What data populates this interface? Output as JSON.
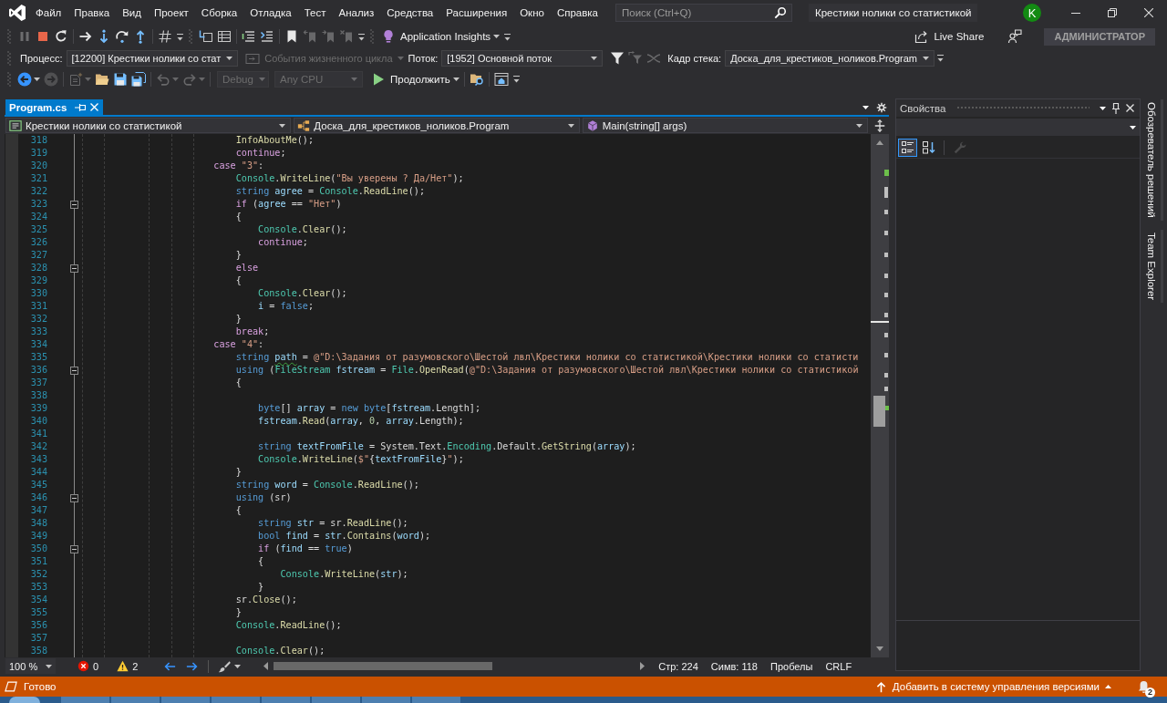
{
  "menu": [
    "Файл",
    "Правка",
    "Вид",
    "Проект",
    "Сборка",
    "Отладка",
    "Тест",
    "Анализ",
    "Средства",
    "Расширения",
    "Окно",
    "Справка"
  ],
  "search": {
    "placeholder": "Поиск (Ctrl+Q)"
  },
  "solution_title": "Крестики нолики со статистикой",
  "account": {
    "initial": "K"
  },
  "debug_toolbar": {
    "bands": [
      {
        "groups": [
          [
            {
              "kind": "pause",
              "disabled": true,
              "has_menu": false
            },
            {
              "kind": "stop",
              "disabled": false,
              "has_menu": false
            },
            {
              "kind": "restart",
              "disabled": false,
              "has_menu": false
            }
          ],
          [
            {
              "kind": "show_next",
              "disabled": false,
              "has_menu": false
            },
            {
              "kind": "step_into",
              "disabled": false,
              "has_menu": false
            },
            {
              "kind": "step_over",
              "disabled": false,
              "has_menu": false
            },
            {
              "kind": "step_out",
              "disabled": false,
              "has_menu": false
            }
          ],
          [
            {
              "kind": "hex",
              "disabled": false,
              "has_menu": false
            }
          ]
        ]
      },
      {
        "groups": [
          [
            {
              "kind": "threads",
              "disabled": false,
              "has_menu": false
            },
            {
              "kind": "callstack",
              "disabled": false,
              "has_menu": false
            }
          ],
          [
            {
              "kind": "comment",
              "disabled": false,
              "has_menu": false
            },
            {
              "kind": "uncomment",
              "disabled": false,
              "has_menu": false
            }
          ],
          [
            {
              "kind": "bookmark",
              "disabled": false,
              "has_menu": false
            },
            {
              "kind": "prev_bookmark",
              "disabled": true,
              "has_menu": false
            },
            {
              "kind": "next_bookmark",
              "disabled": true,
              "has_menu": false
            },
            {
              "kind": "clear_bookmarks",
              "disabled": true,
              "has_menu": false
            }
          ]
        ]
      },
      {
        "groups": [
          [
            {
              "kind": "insights",
              "label": "Application Insights",
              "disabled": false,
              "has_menu": true
            }
          ]
        ]
      }
    ]
  },
  "share_bar": {
    "live_share": "Live Share",
    "role": "АДМИНИСТРАТОР"
  },
  "debug_location": {
    "process": {
      "label": "Процесс:",
      "value": "[12200] Крестики нолики со стат"
    },
    "lifecycle": {
      "label": "События жизненного цикла",
      "disabled": true
    },
    "thread": {
      "label": "Поток:",
      "value": "[1952] Основной поток"
    },
    "thread_tools": [
      {
        "kind": "filter",
        "disabled": false
      },
      {
        "kind": "flag_filter",
        "disabled": true
      },
      {
        "kind": "expand_threads",
        "disabled": true
      }
    ],
    "frame": {
      "label": "Кадр стека:",
      "value": "Доска_для_крестиков_ноликов.Program"
    }
  },
  "standard_toolbar": {
    "bands": [
      {
        "groups": [
          [
            {
              "kind": "back",
              "disabled": false,
              "has_menu": true
            },
            {
              "kind": "forward",
              "disabled": true,
              "has_menu": false
            }
          ],
          [
            {
              "kind": "new_project",
              "disabled": true,
              "has_menu": true
            },
            {
              "kind": "open",
              "disabled": false,
              "has_menu": false
            },
            {
              "kind": "save",
              "disabled": false,
              "has_menu": false
            },
            {
              "kind": "save_all",
              "disabled": false,
              "has_menu": false
            }
          ],
          [
            {
              "kind": "undo",
              "disabled": true,
              "has_menu": true
            },
            {
              "kind": "redo",
              "disabled": true,
              "has_menu": true
            }
          ],
          [
            {
              "kind": "configuration",
              "value": "Debug",
              "disabled": true,
              "has_menu": true
            },
            {
              "kind": "platform",
              "value": "Any CPU",
              "disabled": true,
              "has_menu": true
            },
            {
              "kind": "continue",
              "label": "Продолжить",
              "disabled": false,
              "has_menu": true
            }
          ],
          [
            {
              "kind": "find_in_files",
              "disabled": false,
              "has_menu": false
            }
          ],
          [
            {
              "kind": "browser",
              "disabled": false,
              "has_menu": false
            }
          ]
        ]
      }
    ]
  },
  "document_tabs": [
    {
      "label": "Program.cs",
      "selected": true
    }
  ],
  "navigation_bar": {
    "project": "Крестики нолики со статистикой",
    "type": "Доска_для_крестиков_ноликов.Program",
    "member": "Main(string[] args)"
  },
  "editor": {
    "lines": [
      {
        "number": "318",
        "fold": false,
        "tokens": [
          {
            "kind": "method",
            "text": "\t\t\t\t\t\t\tInfoAboutMe"
          },
          {
            "kind": "plain",
            "text": "();"
          }
        ]
      },
      {
        "number": "319",
        "fold": false,
        "tokens": [
          {
            "kind": "ctrl",
            "text": "\t\t\t\t\t\t\tcontinue"
          },
          {
            "kind": "plain",
            "text": ";"
          }
        ]
      },
      {
        "number": "320",
        "fold": false,
        "tokens": [
          {
            "kind": "ctrl",
            "text": "\t\t\t\t\t\tcase "
          },
          {
            "kind": "str",
            "text": "\"3\""
          },
          {
            "kind": "plain",
            "text": ":"
          }
        ]
      },
      {
        "number": "321",
        "fold": false,
        "tokens": [
          {
            "kind": "type",
            "text": "\t\t\t\t\t\t\tConsole"
          },
          {
            "kind": "plain",
            "text": "."
          },
          {
            "kind": "method",
            "text": "WriteLine"
          },
          {
            "kind": "plain",
            "text": "("
          },
          {
            "kind": "str",
            "text": "\"Вы уверены ? Да/Нет\""
          },
          {
            "kind": "plain",
            "text": ");"
          }
        ]
      },
      {
        "number": "322",
        "fold": false,
        "tokens": [
          {
            "kind": "kw",
            "text": "\t\t\t\t\t\t\tstring "
          },
          {
            "kind": "local",
            "text": "agree"
          },
          {
            "kind": "plain",
            "text": " = "
          },
          {
            "kind": "type",
            "text": "Console"
          },
          {
            "kind": "plain",
            "text": "."
          },
          {
            "kind": "method",
            "text": "ReadLine"
          },
          {
            "kind": "plain",
            "text": "();"
          }
        ]
      },
      {
        "number": "323",
        "fold": true,
        "tokens": [
          {
            "kind": "ctrl",
            "text": "\t\t\t\t\t\t\tif"
          },
          {
            "kind": "plain",
            "text": " ("
          },
          {
            "kind": "local",
            "text": "agree"
          },
          {
            "kind": "plain",
            "text": " == "
          },
          {
            "kind": "str",
            "text": "\"Нет\""
          },
          {
            "kind": "plain",
            "text": ")"
          }
        ]
      },
      {
        "number": "324",
        "fold": false,
        "tokens": [
          {
            "kind": "plain",
            "text": "\t\t\t\t\t\t\t{"
          }
        ]
      },
      {
        "number": "325",
        "fold": false,
        "tokens": [
          {
            "kind": "type",
            "text": "\t\t\t\t\t\t\t\tConsole"
          },
          {
            "kind": "plain",
            "text": "."
          },
          {
            "kind": "method",
            "text": "Clear"
          },
          {
            "kind": "plain",
            "text": "();"
          }
        ]
      },
      {
        "number": "326",
        "fold": false,
        "tokens": [
          {
            "kind": "ctrl",
            "text": "\t\t\t\t\t\t\t\tcontinue"
          },
          {
            "kind": "plain",
            "text": ";"
          }
        ]
      },
      {
        "number": "327",
        "fold": false,
        "tokens": [
          {
            "kind": "plain",
            "text": "\t\t\t\t\t\t\t}"
          }
        ]
      },
      {
        "number": "328",
        "fold": true,
        "tokens": [
          {
            "kind": "ctrl",
            "text": "\t\t\t\t\t\t\telse"
          }
        ]
      },
      {
        "number": "329",
        "fold": false,
        "tokens": [
          {
            "kind": "plain",
            "text": "\t\t\t\t\t\t\t{"
          }
        ]
      },
      {
        "number": "330",
        "fold": false,
        "tokens": [
          {
            "kind": "type",
            "text": "\t\t\t\t\t\t\t\tConsole"
          },
          {
            "kind": "plain",
            "text": "."
          },
          {
            "kind": "method",
            "text": "Clear"
          },
          {
            "kind": "plain",
            "text": "();"
          }
        ]
      },
      {
        "number": "331",
        "fold": false,
        "tokens": [
          {
            "kind": "local",
            "text": "\t\t\t\t\t\t\t\ti"
          },
          {
            "kind": "plain",
            "text": " = "
          },
          {
            "kind": "kw",
            "text": "false"
          },
          {
            "kind": "plain",
            "text": ";"
          }
        ]
      },
      {
        "number": "332",
        "fold": false,
        "tokens": [
          {
            "kind": "plain",
            "text": "\t\t\t\t\t\t\t}"
          }
        ]
      },
      {
        "number": "333",
        "fold": false,
        "tokens": [
          {
            "kind": "ctrl",
            "text": "\t\t\t\t\t\t\tbreak"
          },
          {
            "kind": "plain",
            "text": ";"
          }
        ]
      },
      {
        "number": "334",
        "fold": false,
        "tokens": [
          {
            "kind": "ctrl",
            "text": "\t\t\t\t\t\tcase "
          },
          {
            "kind": "str",
            "text": "\"4\""
          },
          {
            "kind": "plain",
            "text": ":"
          }
        ]
      },
      {
        "number": "335",
        "fold": false,
        "tokens": [
          {
            "kind": "kw",
            "text": "\t\t\t\t\t\t\tstring "
          },
          {
            "kind": "warn",
            "text": "path"
          },
          {
            "kind": "plain",
            "text": " = "
          },
          {
            "kind": "str",
            "text": "@\"D:\\Задания от разумовского\\Шестой лвл\\Крестики нолики со статистикой\\Крестики нолики со статисти"
          }
        ]
      },
      {
        "number": "336",
        "fold": true,
        "tokens": [
          {
            "kind": "kw",
            "text": "\t\t\t\t\t\t\tusing"
          },
          {
            "kind": "plain",
            "text": " ("
          },
          {
            "kind": "type",
            "text": "FileStream "
          },
          {
            "kind": "local",
            "text": "fstream"
          },
          {
            "kind": "plain",
            "text": " = "
          },
          {
            "kind": "type",
            "text": "File"
          },
          {
            "kind": "plain",
            "text": "."
          },
          {
            "kind": "method",
            "text": "OpenRead"
          },
          {
            "kind": "plain",
            "text": "("
          },
          {
            "kind": "str",
            "text": "@\"D:\\Задания от разумовского\\Шестой лвл\\Крестики нолики со статистикой"
          }
        ]
      },
      {
        "number": "337",
        "fold": false,
        "tokens": [
          {
            "kind": "plain",
            "text": "\t\t\t\t\t\t\t{"
          }
        ]
      },
      {
        "number": "338",
        "fold": false
      },
      {
        "number": "339",
        "fold": false,
        "tokens": [
          {
            "kind": "kw",
            "text": "\t\t\t\t\t\t\t\tbyte"
          },
          {
            "kind": "plain",
            "text": "[] "
          },
          {
            "kind": "local",
            "text": "array"
          },
          {
            "kind": "plain",
            "text": " = "
          },
          {
            "kind": "kw",
            "text": "new byte"
          },
          {
            "kind": "plain",
            "text": "["
          },
          {
            "kind": "local",
            "text": "fstream"
          },
          {
            "kind": "plain",
            "text": ".Length];"
          }
        ]
      },
      {
        "number": "340",
        "fold": false,
        "tokens": [
          {
            "kind": "local",
            "text": "\t\t\t\t\t\t\t\tfstream"
          },
          {
            "kind": "plain",
            "text": "."
          },
          {
            "kind": "method",
            "text": "Read"
          },
          {
            "kind": "plain",
            "text": "("
          },
          {
            "kind": "local",
            "text": "array"
          },
          {
            "kind": "plain",
            "text": ", "
          },
          {
            "kind": "num",
            "text": "0"
          },
          {
            "kind": "plain",
            "text": ", "
          },
          {
            "kind": "local",
            "text": "array"
          },
          {
            "kind": "plain",
            "text": ".Length);"
          }
        ]
      },
      {
        "number": "341",
        "fold": false
      },
      {
        "number": "342",
        "fold": false,
        "tokens": [
          {
            "kind": "kw",
            "text": "\t\t\t\t\t\t\t\tstring "
          },
          {
            "kind": "local",
            "text": "textFromFile"
          },
          {
            "kind": "plain",
            "text": " = System.Text."
          },
          {
            "kind": "type",
            "text": "Encoding"
          },
          {
            "kind": "plain",
            "text": ".Default."
          },
          {
            "kind": "method",
            "text": "GetString"
          },
          {
            "kind": "plain",
            "text": "("
          },
          {
            "kind": "local",
            "text": "array"
          },
          {
            "kind": "plain",
            "text": ");"
          }
        ]
      },
      {
        "number": "343",
        "fold": false,
        "tokens": [
          {
            "kind": "type",
            "text": "\t\t\t\t\t\t\t\tConsole"
          },
          {
            "kind": "plain",
            "text": "."
          },
          {
            "kind": "method",
            "text": "WriteLine"
          },
          {
            "kind": "plain",
            "text": "("
          },
          {
            "kind": "str",
            "text": "$\""
          },
          {
            "kind": "plain",
            "text": "{"
          },
          {
            "kind": "local",
            "text": "textFromFile"
          },
          {
            "kind": "plain",
            "text": "}"
          },
          {
            "kind": "str",
            "text": "\""
          },
          {
            "kind": "plain",
            "text": ");"
          }
        ]
      },
      {
        "number": "344",
        "fold": false,
        "tokens": [
          {
            "kind": "plain",
            "text": "\t\t\t\t\t\t\t}"
          }
        ]
      },
      {
        "number": "345",
        "fold": false,
        "tokens": [
          {
            "kind": "kw",
            "text": "\t\t\t\t\t\t\tstring "
          },
          {
            "kind": "local",
            "text": "word"
          },
          {
            "kind": "plain",
            "text": " = "
          },
          {
            "kind": "type",
            "text": "Console"
          },
          {
            "kind": "plain",
            "text": "."
          },
          {
            "kind": "method",
            "text": "ReadLine"
          },
          {
            "kind": "plain",
            "text": "();"
          }
        ]
      },
      {
        "number": "346",
        "fold": true,
        "tokens": [
          {
            "kind": "kw",
            "text": "\t\t\t\t\t\t\tusing"
          },
          {
            "kind": "plain",
            "text": " (sr)"
          }
        ]
      },
      {
        "number": "347",
        "fold": false,
        "tokens": [
          {
            "kind": "plain",
            "text": "\t\t\t\t\t\t\t{"
          }
        ]
      },
      {
        "number": "348",
        "fold": false,
        "tokens": [
          {
            "kind": "kw",
            "text": "\t\t\t\t\t\t\t\tstring "
          },
          {
            "kind": "local",
            "text": "str"
          },
          {
            "kind": "plain",
            "text": " = sr."
          },
          {
            "kind": "method",
            "text": "ReadLine"
          },
          {
            "kind": "plain",
            "text": "();"
          }
        ]
      },
      {
        "number": "349",
        "fold": false,
        "tokens": [
          {
            "kind": "kw",
            "text": "\t\t\t\t\t\t\t\tbool "
          },
          {
            "kind": "local",
            "text": "find"
          },
          {
            "kind": "plain",
            "text": " = "
          },
          {
            "kind": "local",
            "text": "str"
          },
          {
            "kind": "plain",
            "text": "."
          },
          {
            "kind": "method",
            "text": "Contains"
          },
          {
            "kind": "plain",
            "text": "("
          },
          {
            "kind": "local",
            "text": "word"
          },
          {
            "kind": "plain",
            "text": ");"
          }
        ]
      },
      {
        "number": "350",
        "fold": true,
        "tokens": [
          {
            "kind": "ctrl",
            "text": "\t\t\t\t\t\t\t\tif"
          },
          {
            "kind": "plain",
            "text": " ("
          },
          {
            "kind": "local",
            "text": "find"
          },
          {
            "kind": "plain",
            "text": " == "
          },
          {
            "kind": "kw",
            "text": "true"
          },
          {
            "kind": "plain",
            "text": ")"
          }
        ]
      },
      {
        "number": "351",
        "fold": false,
        "tokens": [
          {
            "kind": "plain",
            "text": "\t\t\t\t\t\t\t\t{"
          }
        ]
      },
      {
        "number": "352",
        "fold": false,
        "tokens": [
          {
            "kind": "type",
            "text": "\t\t\t\t\t\t\t\t\tConsole"
          },
          {
            "kind": "plain",
            "text": "."
          },
          {
            "kind": "method",
            "text": "WriteLine"
          },
          {
            "kind": "plain",
            "text": "("
          },
          {
            "kind": "local",
            "text": "str"
          },
          {
            "kind": "plain",
            "text": ");"
          }
        ]
      },
      {
        "number": "353",
        "fold": false,
        "tokens": [
          {
            "kind": "plain",
            "text": "\t\t\t\t\t\t\t\t}"
          }
        ]
      },
      {
        "number": "354",
        "fold": false,
        "tokens": [
          {
            "kind": "plain",
            "text": "\t\t\t\t\t\t\tsr."
          },
          {
            "kind": "method",
            "text": "Close"
          },
          {
            "kind": "plain",
            "text": "();"
          }
        ]
      },
      {
        "number": "355",
        "fold": false,
        "tokens": [
          {
            "kind": "plain",
            "text": "\t\t\t\t\t\t\t}"
          }
        ]
      },
      {
        "number": "356",
        "fold": false,
        "tokens": [
          {
            "kind": "type",
            "text": "\t\t\t\t\t\t\tConsole"
          },
          {
            "kind": "plain",
            "text": "."
          },
          {
            "kind": "method",
            "text": "ReadLine"
          },
          {
            "kind": "plain",
            "text": "();"
          }
        ]
      },
      {
        "number": "357",
        "fold": false
      },
      {
        "number": "358",
        "fold": false,
        "tokens": [
          {
            "kind": "type",
            "text": "\t\t\t\t\t\t\tConsole"
          },
          {
            "kind": "plain",
            "text": "."
          },
          {
            "kind": "method",
            "text": "Clear"
          },
          {
            "kind": "plain",
            "text": "();"
          }
        ]
      }
    ]
  },
  "editor_footer": {
    "zoom": "100 %",
    "errors": "0",
    "warnings": "2",
    "line": "Стр: 224",
    "column": "Симв: 118",
    "indentation": "Пробелы",
    "line_endings": "CRLF"
  },
  "properties_panel": {
    "title": "Свойства",
    "tools": [
      {
        "kind": "categorized",
        "selected": true,
        "disabled": false
      },
      {
        "kind": "alphabetical",
        "selected": false,
        "disabled": false
      },
      {
        "kind": "property_pages",
        "selected": false,
        "disabled": true
      }
    ]
  },
  "side_tabs": [
    "Обозреватель решений",
    "Team Explorer"
  ],
  "status_bar": {
    "text": "Готово",
    "source_control": "Добавить в систему управления версиями",
    "notifications": "2"
  }
}
